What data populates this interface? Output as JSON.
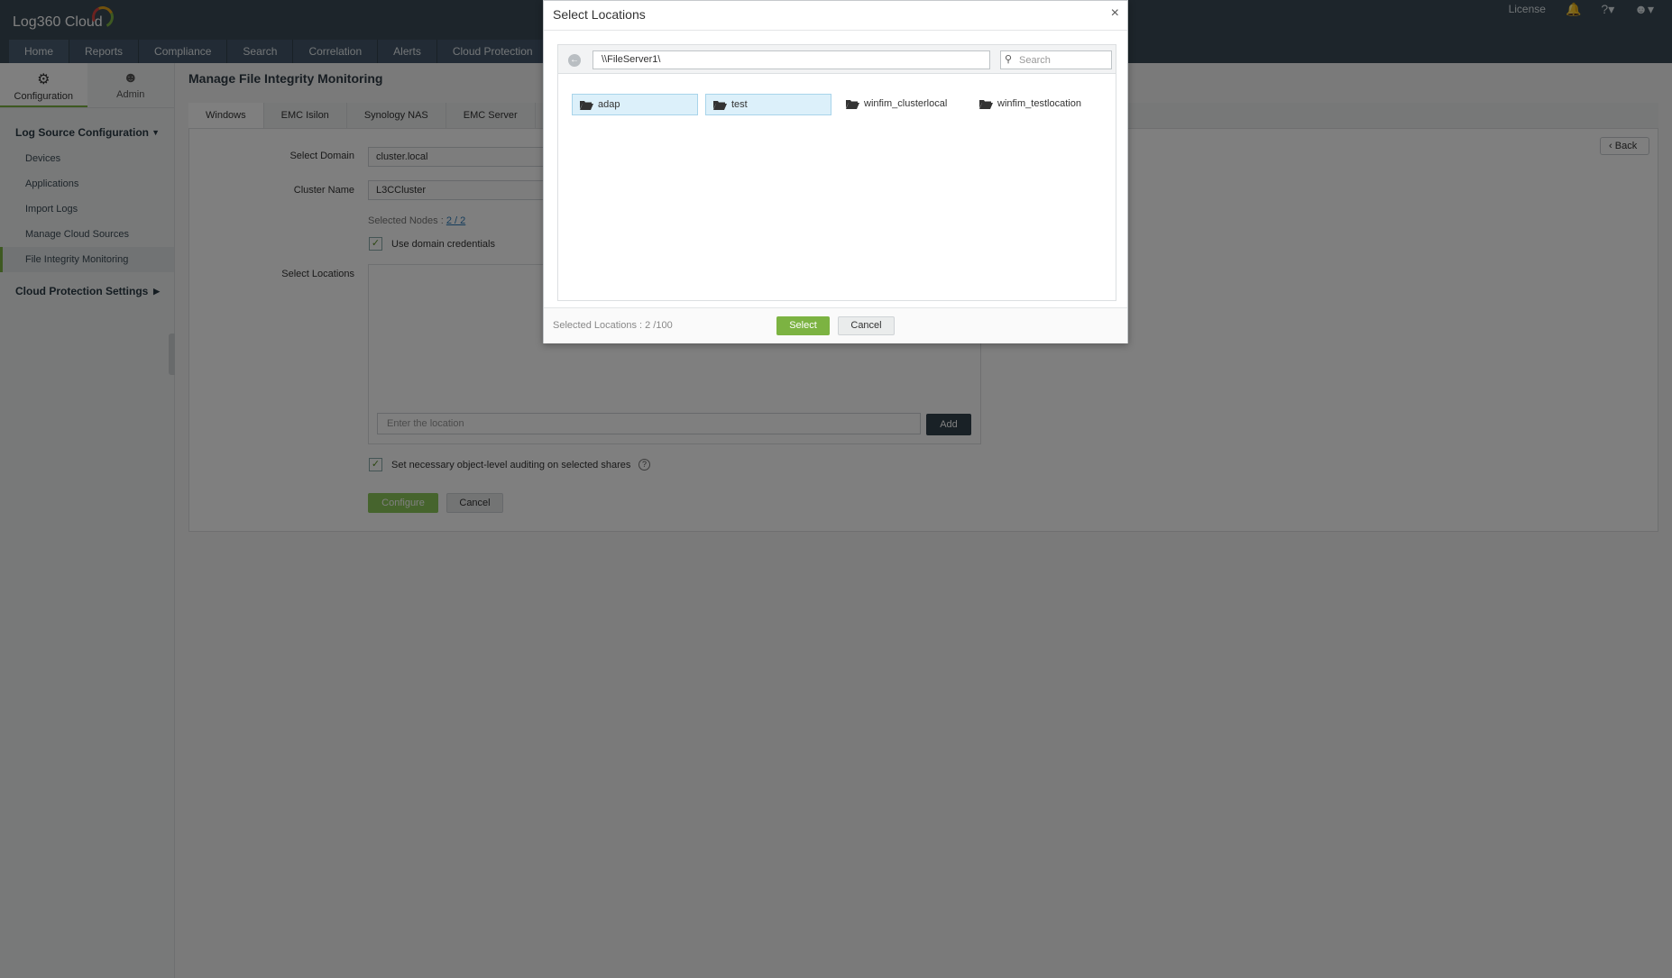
{
  "app": {
    "logo_text": "Log360 Cloud"
  },
  "header": {
    "license_label": "License",
    "nav": [
      "Home",
      "Reports",
      "Compliance",
      "Search",
      "Correlation",
      "Alerts",
      "Cloud Protection"
    ]
  },
  "sidebar": {
    "tabs": [
      {
        "label": "Configuration",
        "icon": "gear-icon"
      },
      {
        "label": "Admin",
        "icon": "user-icon"
      }
    ],
    "section1": "Log Source Configuration",
    "items": [
      "Devices",
      "Applications",
      "Import Logs",
      "Manage Cloud Sources",
      "File Integrity Monitoring"
    ],
    "section2": "Cloud Protection Settings"
  },
  "main": {
    "title": "Manage File Integrity Monitoring",
    "tabs": [
      "Windows",
      "EMC Isilon",
      "Synology NAS",
      "EMC Server"
    ],
    "back_label": "Back",
    "select_domain_label": "Select Domain",
    "select_domain_value": "cluster.local",
    "cluster_name_label": "Cluster Name",
    "cluster_name_value": "L3CCluster",
    "selected_nodes_label": "Selected Nodes :",
    "selected_nodes_value": "2 / 2",
    "use_domain_credentials": "Use domain credentials",
    "select_locations_label": "Select Locations",
    "location_placeholder": "Enter the location",
    "add_label": "Add",
    "auditing_label": "Set necessary object-level auditing on selected shares",
    "configure_label": "Configure",
    "cancel_label": "Cancel"
  },
  "modal": {
    "title": "Select Locations",
    "path": "\\\\FileServer1\\",
    "search_placeholder": "Search",
    "folders": [
      {
        "name": "adap",
        "selected": true
      },
      {
        "name": "test",
        "selected": true
      },
      {
        "name": "winfim_clusterlocal",
        "selected": false
      },
      {
        "name": "winfim_testlocation",
        "selected": false
      }
    ],
    "selected_count": "Selected Locations : 2 /100",
    "select_label": "Select",
    "cancel_label": "Cancel"
  }
}
